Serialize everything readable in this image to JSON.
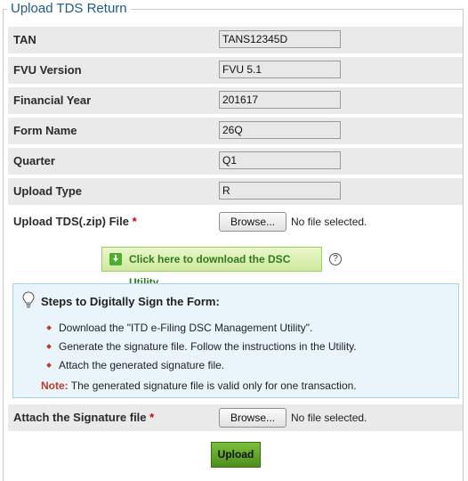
{
  "legend": "Upload TDS Return",
  "fields": [
    {
      "label": "TAN",
      "value": "TANS12345D"
    },
    {
      "label": "FVU Version",
      "value": "FVU 5.1"
    },
    {
      "label": "Financial Year",
      "value": "201617"
    },
    {
      "label": "Form Name",
      "value": "26Q"
    },
    {
      "label": "Quarter",
      "value": "Q1"
    },
    {
      "label": "Upload Type",
      "value": "R"
    }
  ],
  "zip_file": {
    "label": "Upload TDS(.zip) File",
    "required": "*",
    "browse": "Browse...",
    "status": "No file selected."
  },
  "dsc_download": {
    "label": "Click here to download the DSC Utility",
    "help": "?"
  },
  "steps": {
    "title": "Steps to Digitally Sign the Form:",
    "items": [
      "Download the \"ITD e-Filing DSC Management Utility\".",
      "Generate the signature file. Follow the instructions in the Utility.",
      "Attach the generated signature file."
    ],
    "note_label": "Note:",
    "note_text": " The generated signature file is valid only for one transaction."
  },
  "signature_file": {
    "label": "Attach the Signature file",
    "required": "*",
    "browse": "Browse...",
    "status": "No file selected."
  },
  "upload_button": "Upload",
  "colors": {
    "legend": "#1c5a8c",
    "required": "#d00000",
    "dsc_text": "#2f7a1f",
    "upload_bg": "#5fa52a",
    "steps_bg": "#e9f5fb"
  },
  "icons": {
    "download": "download-icon",
    "help": "help-circle-icon",
    "steps": "lightbulb-icon"
  }
}
